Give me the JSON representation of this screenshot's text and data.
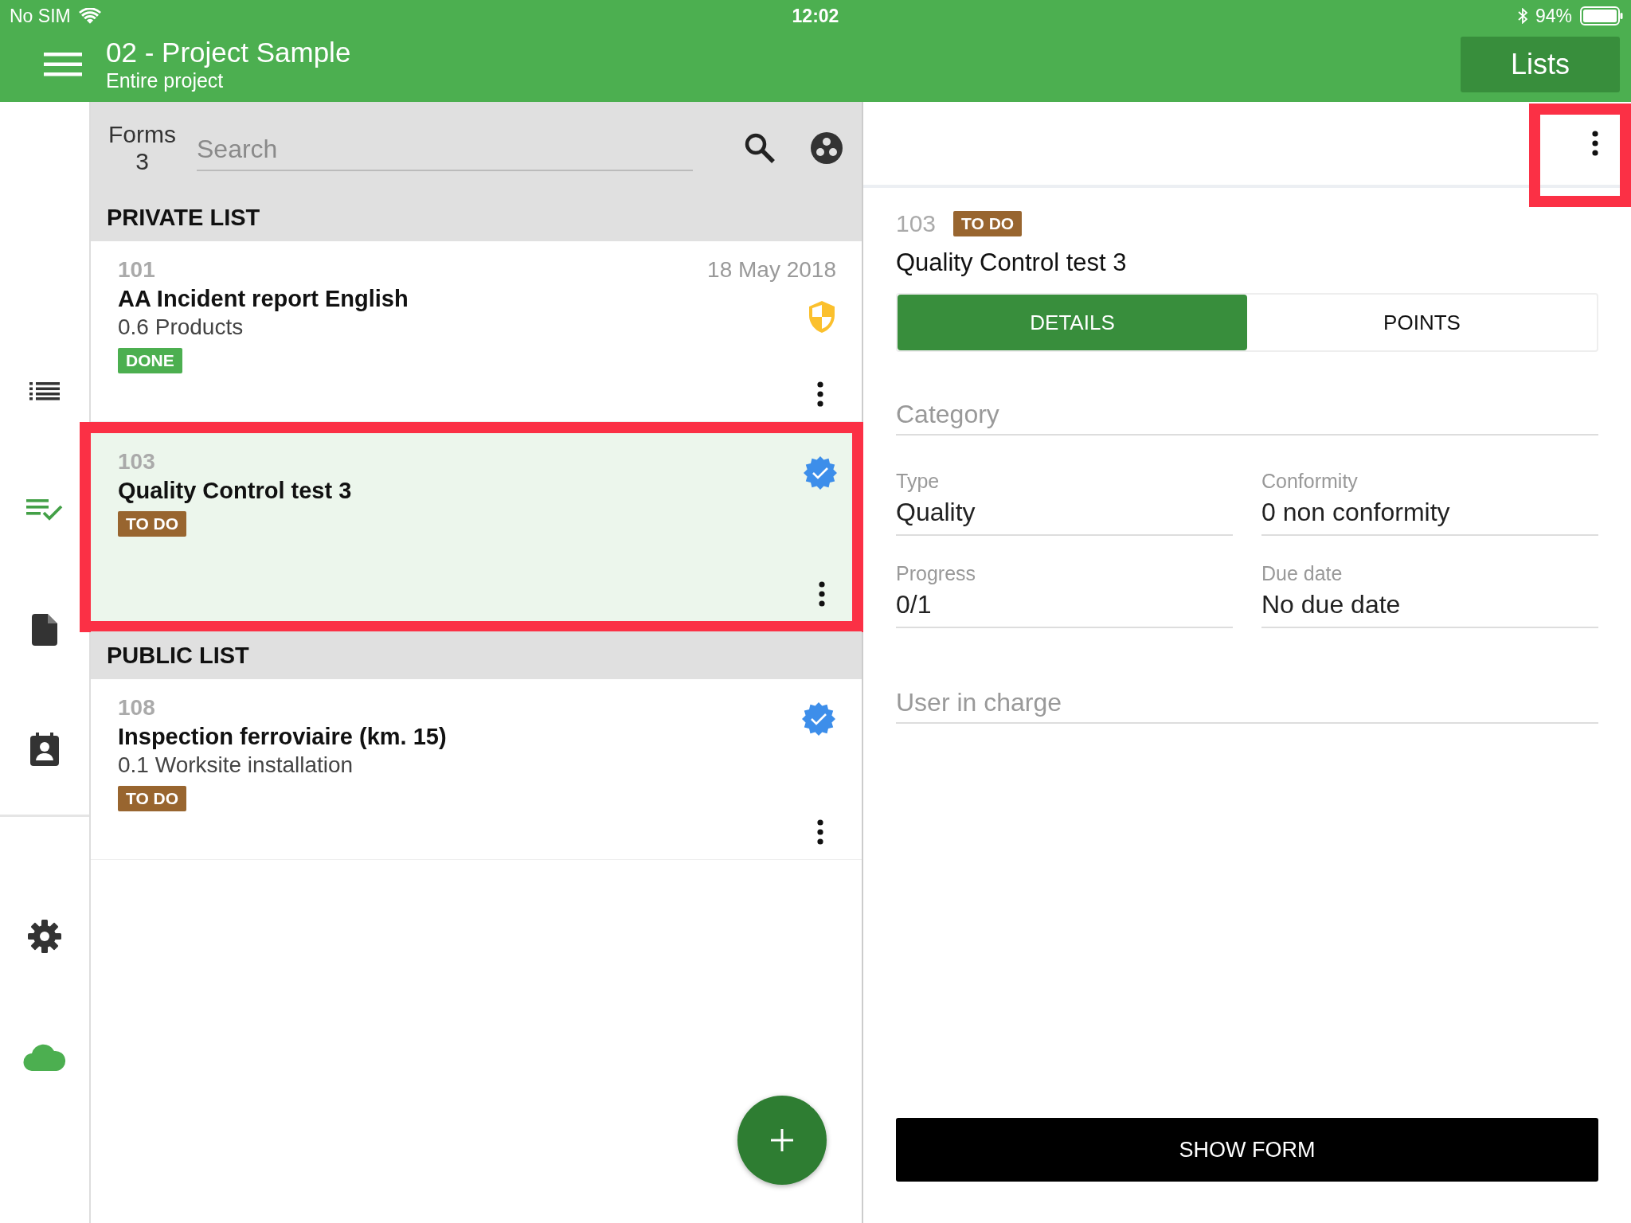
{
  "status_bar": {
    "carrier": "No SIM",
    "time": "12:02",
    "battery": "94%"
  },
  "app_bar": {
    "title": "02 - Project Sample",
    "subtitle": "Entire project",
    "action": "Lists"
  },
  "rail": {
    "items": [
      {
        "selected": false
      },
      {
        "selected": true
      },
      {
        "selected": false
      },
      {
        "selected": false
      }
    ]
  },
  "list_panel": {
    "count_label": "Forms",
    "count": "3",
    "search": {
      "placeholder": "Search"
    },
    "sections": [
      {
        "title": "PRIVATE LIST",
        "cards": [
          {
            "number": "101",
            "title": "AA Incident report English",
            "subtitle": "0.6 Products",
            "date": "18 May 2018",
            "badge": {
              "text": "DONE",
              "color": "#4caf50"
            },
            "kind": "warning",
            "selected": false,
            "highlighted": false
          },
          {
            "number": "103",
            "title": "Quality Control test 3",
            "badge": {
              "text": "TO DO",
              "color": "#98652f"
            },
            "kind": "verified",
            "selected": true,
            "highlighted": true
          }
        ]
      },
      {
        "title": "PUBLIC LIST",
        "cards": [
          {
            "number": "108",
            "title": "Inspection ferroviaire (km. 15)",
            "subtitle": "0.1 Worksite installation",
            "badge": {
              "text": "TO DO",
              "color": "#98652f"
            },
            "kind": "verified",
            "selected": false,
            "highlighted": false
          }
        ]
      }
    ]
  },
  "detail": {
    "menu_highlighted": true,
    "number": "103",
    "badge": {
      "text": "TO DO",
      "color": "#98652f"
    },
    "title": "Quality Control test 3",
    "tabs": [
      {
        "label": "DETAILS",
        "selected": true
      },
      {
        "label": "POINTS",
        "selected": false
      }
    ],
    "fields": [
      {
        "kind": "full",
        "label": "Category"
      },
      {
        "kind": "pair",
        "items": [
          {
            "label": "Type",
            "value": "Quality"
          },
          {
            "label": "Conformity",
            "value": "0 non conformity"
          }
        ]
      },
      {
        "kind": "pair",
        "items": [
          {
            "label": "Progress",
            "value": "0/1"
          },
          {
            "label": "Due date",
            "value": "No due date"
          }
        ]
      },
      {
        "kind": "full",
        "label": "User in charge"
      }
    ],
    "button": "SHOW FORM"
  }
}
